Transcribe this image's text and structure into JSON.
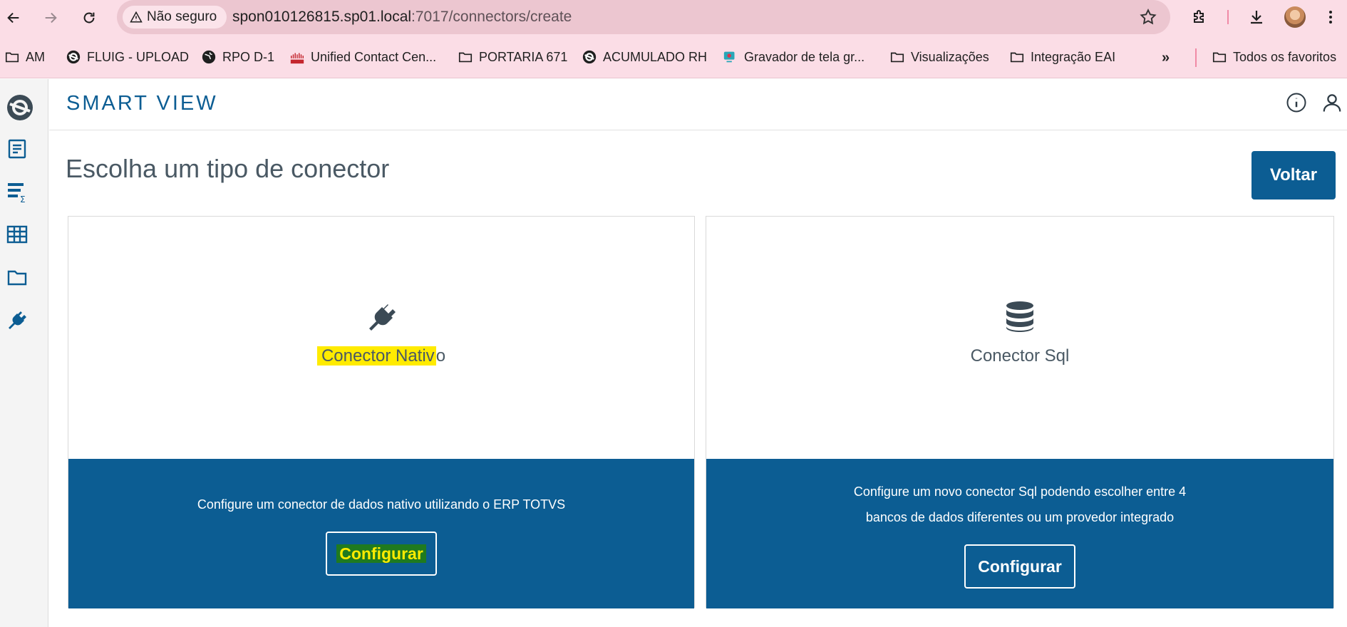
{
  "browser": {
    "security_label": "Não seguro",
    "url_host": "spon010126815.sp01.local",
    "url_path": ":7017/connectors/create",
    "bookmarks": [
      "AM",
      "FLUIG - UPLOAD",
      "RPO D-1",
      "Unified Contact Cen...",
      "PORTARIA 671",
      "ACUMULADO RH",
      "Gravador de tela gr...",
      "Visualizações",
      "Integração EAI"
    ],
    "overflow": "»",
    "all_bookmarks": "Todos os favoritos"
  },
  "app": {
    "title": "SMART VIEW",
    "sidebar_icons": [
      "logo-icon",
      "report-icon",
      "list-sum-icon",
      "table-icon",
      "folder-icon",
      "plug-icon"
    ],
    "accent_color": "#0c5d93"
  },
  "page": {
    "heading": "Escolha um tipo de conector",
    "back_button": "Voltar"
  },
  "cards": {
    "native": {
      "title_highlighted": "Conector Nativ",
      "title_rest": "o",
      "description": "Configure um conector de dados nativo utilizando o ERP TOTVS",
      "button": "Configurar",
      "icon": "plug-icon"
    },
    "sql": {
      "title": "Conector Sql",
      "description_line1": "Configure um novo conector Sql podendo escolher entre 4",
      "description_line2": "bancos de dados diferentes ou um provedor integrado",
      "button": "Configurar",
      "icon": "database-icon"
    }
  }
}
